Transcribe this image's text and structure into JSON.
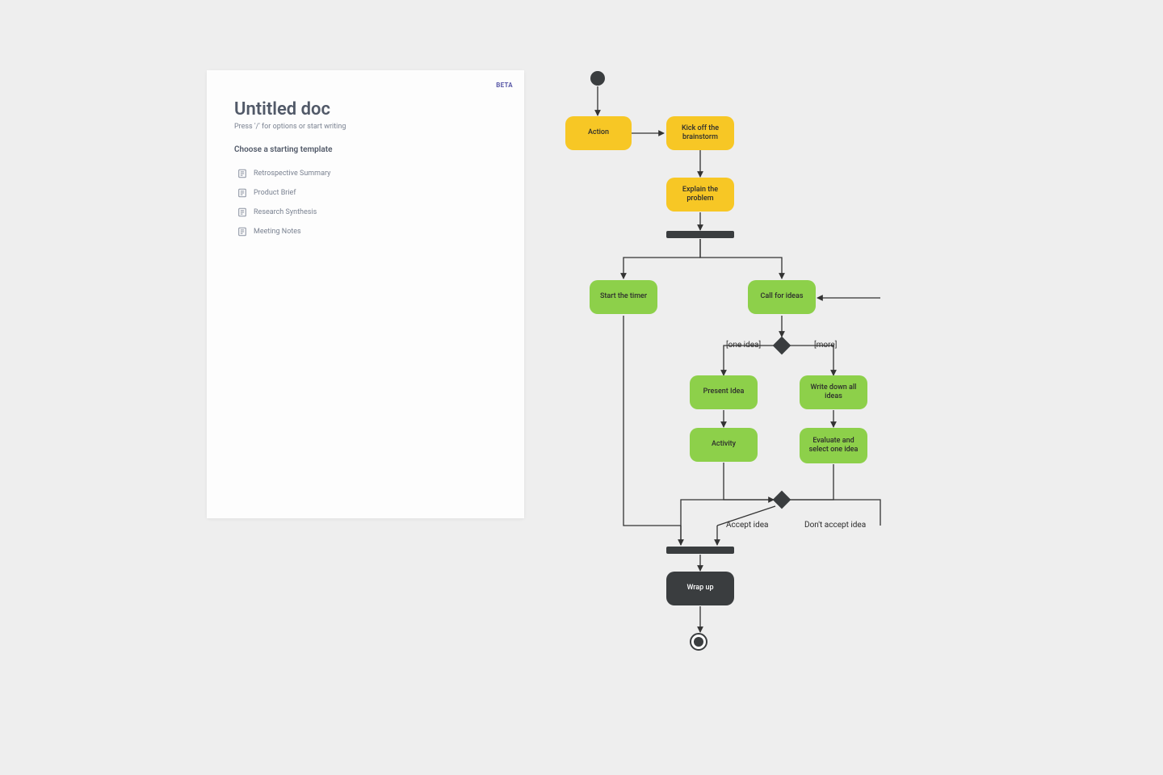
{
  "doc": {
    "beta_badge": "BETA",
    "title": "Untitled doc",
    "hint": "Press '/' for options or start writing",
    "choose_label": "Choose a starting template",
    "templates": [
      {
        "label": "Retrospective Summary"
      },
      {
        "label": "Product Brief"
      },
      {
        "label": "Research Synthesis"
      },
      {
        "label": "Meeting Notes"
      }
    ]
  },
  "flow": {
    "start_node": "start",
    "end_node": "end",
    "nodes": {
      "action": {
        "label": "Action",
        "color": "yellow"
      },
      "kickoff": {
        "label": "Kick off the brainstorm",
        "color": "yellow"
      },
      "explain": {
        "label": "Explain the problem",
        "color": "yellow"
      },
      "start_timer": {
        "label": "Start the timer",
        "color": "green"
      },
      "call_ideas": {
        "label": "Call for ideas",
        "color": "green"
      },
      "present_idea": {
        "label": "Present Idea",
        "color": "green"
      },
      "write_all": {
        "label": "Write down all ideas",
        "color": "green"
      },
      "activity": {
        "label": "Activity",
        "color": "green"
      },
      "evaluate": {
        "label": "Evaluate and select one idea",
        "color": "green"
      },
      "wrapup": {
        "label": "Wrap up",
        "color": "dark"
      }
    },
    "edge_labels": {
      "one_idea": "[one idea]",
      "more": "[more]",
      "accept": "Accept idea",
      "dont_accept": "Don't accept idea"
    }
  }
}
